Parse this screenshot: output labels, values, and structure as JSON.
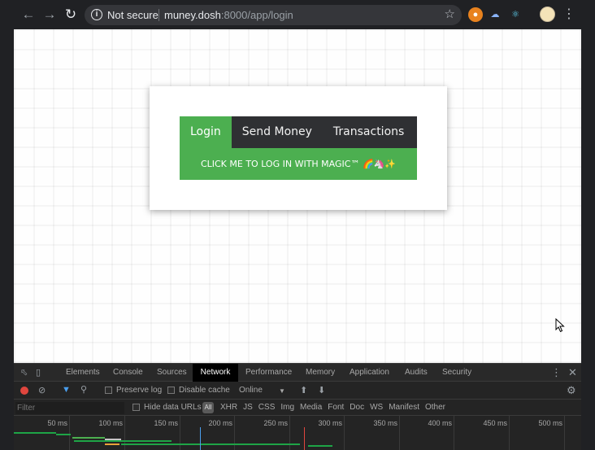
{
  "browser": {
    "security_label": "Not secure",
    "url_host": "muney.dosh",
    "url_rest": ":8000/app/login"
  },
  "page": {
    "tabs": [
      {
        "label": "Login",
        "active": true
      },
      {
        "label": "Send Money",
        "active": false
      },
      {
        "label": "Transactions",
        "active": false
      }
    ],
    "magic_button_label": "CLICK ME TO LOG IN WITH MAGIC™ 🌈🦄✨",
    "accent_color": "#4caf50",
    "tab_bar_color": "#2f3033"
  },
  "devtools": {
    "tabs": [
      "Elements",
      "Console",
      "Sources",
      "Network",
      "Performance",
      "Memory",
      "Application",
      "Audits",
      "Security"
    ],
    "active_tab": "Network",
    "preserve_log_label": "Preserve log",
    "disable_cache_label": "Disable cache",
    "throttle_value": "Online",
    "filter_placeholder": "Filter",
    "hide_data_urls_label": "Hide data URLs",
    "all_label": "All",
    "filter_types": [
      "XHR",
      "JS",
      "CSS",
      "Img",
      "Media",
      "Font",
      "Doc",
      "WS",
      "Manifest",
      "Other"
    ],
    "timeline_ticks": [
      "50 ms",
      "100 ms",
      "150 ms",
      "200 ms",
      "250 ms",
      "300 ms",
      "350 ms",
      "400 ms",
      "450 ms",
      "500 ms"
    ]
  }
}
